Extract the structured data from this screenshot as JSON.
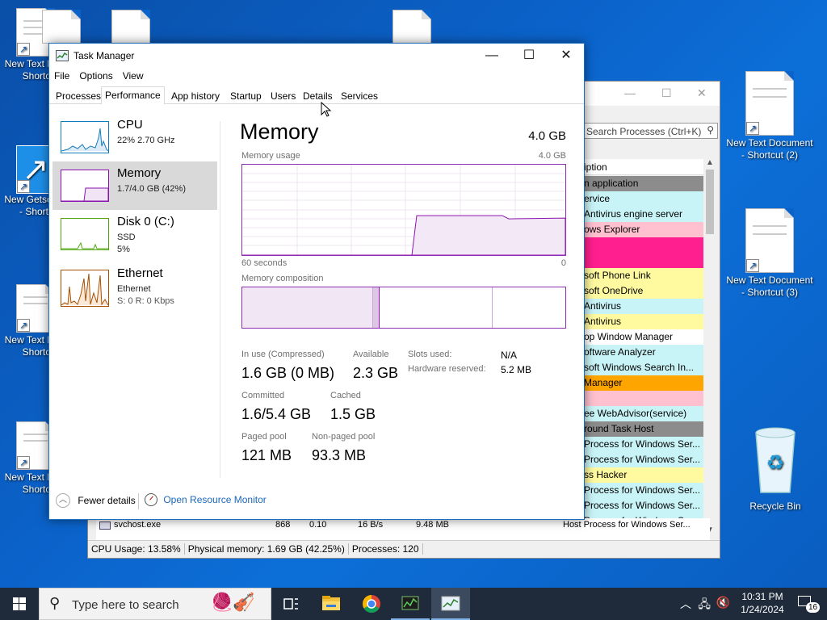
{
  "desktop": {
    "icons_left": [
      {
        "label": "New Text D... - Shortc",
        "label2": ""
      },
      {
        "label": "New Getscre... - Shortc",
        "label2": ""
      },
      {
        "label": "New Text D... - Shortc",
        "label2": ""
      },
      {
        "label": "New Text D... - Shortc",
        "label2": ""
      }
    ],
    "icons_right": [
      {
        "label": "New Text Document",
        "label2": "- Shortcut (2)"
      },
      {
        "label": "New Text Document",
        "label2": "- Shortcut (3)"
      }
    ],
    "recycle_bin": "Recycle Bin"
  },
  "background_window": {
    "search_placeholder": "Search Processes (Ctrl+K)",
    "column_header": "iption",
    "rows": [
      {
        "text": "n application",
        "color": "#8c8c8c"
      },
      {
        "text": "ervice",
        "color": "#c9f4f7"
      },
      {
        "text": "Antivirus engine server",
        "color": "#c9f4f7"
      },
      {
        "text": "ows Explorer",
        "color": "#ffc0d0"
      },
      {
        "text": "",
        "color": "#ff1f8f"
      },
      {
        "text": "",
        "color": "#ff1f8f"
      },
      {
        "text": "soft Phone Link",
        "color": "#fffaa0"
      },
      {
        "text": "soft OneDrive",
        "color": "#fffaa0"
      },
      {
        "text": "Antivirus",
        "color": "#c9f4f7"
      },
      {
        "text": "Antivirus",
        "color": "#fffaa0"
      },
      {
        "text": "op Window Manager",
        "color": "#ffffff"
      },
      {
        "text": "oftware Analyzer",
        "color": "#c9f4f7"
      },
      {
        "text": "soft Windows Search In...",
        "color": "#c9f4f7"
      },
      {
        "text": "Manager",
        "color": "#ffa500"
      },
      {
        "text": "",
        "color": "#ffc0d0"
      },
      {
        "text": "ee WebAdvisor(service)",
        "color": "#c9f4f7"
      },
      {
        "text": "round Task Host",
        "color": "#8c8c8c"
      },
      {
        "text": "Process for Windows Ser...",
        "color": "#c9f4f7"
      },
      {
        "text": "Process for Windows Ser...",
        "color": "#c9f4f7"
      },
      {
        "text": "ss Hacker",
        "color": "#fffaa0"
      },
      {
        "text": "Process for Windows Ser...",
        "color": "#c9f4f7"
      },
      {
        "text": "Process for Windows Ser...",
        "color": "#c9f4f7"
      },
      {
        "text": "Process for Windows Ser...",
        "color": "#c9f4f7"
      }
    ],
    "bottom_row": {
      "name": "svchost.exe",
      "pid": "868",
      "cpu": "0.10",
      "io": "16 B/s",
      "mem": "9.48 MB",
      "desc": "Host Process for Windows Ser..."
    },
    "status": {
      "cpu": "CPU Usage: 13.58%",
      "physical": "Physical memory: 1.69 GB (42.25%)",
      "processes": "Processes: 120"
    }
  },
  "task_manager": {
    "title": "Task Manager",
    "menu": [
      "File",
      "Options",
      "View"
    ],
    "tabs": [
      "Processes",
      "Performance",
      "App history",
      "Startup",
      "Users",
      "Details",
      "Services"
    ],
    "active_tab": "Performance",
    "perf_items": [
      {
        "name": "CPU",
        "sub1": "22% 2.70 GHz",
        "sub2": ""
      },
      {
        "name": "Memory",
        "sub1": "1.7/4.0 GB (42%)",
        "sub2": ""
      },
      {
        "name": "Disk 0 (C:)",
        "sub1": "SSD",
        "sub2": "5%"
      },
      {
        "name": "Ethernet",
        "sub1": "Ethernet",
        "sub2": "S: 0 R: 0 Kbps"
      }
    ],
    "memory": {
      "title": "Memory",
      "total": "4.0 GB",
      "usage_label": "Memory usage",
      "usage_max": "4.0 GB",
      "usage_fraction": 0.42,
      "time_left": "60 seconds",
      "time_right": "0",
      "composition_label": "Memory composition",
      "in_use_label": "In use (Compressed)",
      "in_use": "1.6 GB (0 MB)",
      "available_label": "Available",
      "available": "2.3 GB",
      "slots_label": "Slots used:",
      "slots": "N/A",
      "hw_reserved_label": "Hardware reserved:",
      "hw_reserved": "5.2 MB",
      "committed_label": "Committed",
      "committed": "1.6/5.4 GB",
      "cached_label": "Cached",
      "cached": "1.5 GB",
      "paged_label": "Paged pool",
      "paged": "121 MB",
      "nonpaged_label": "Non-paged pool",
      "nonpaged": "93.3 MB"
    },
    "fewer_details": "Fewer details",
    "open_resource_monitor": "Open Resource Monitor"
  },
  "taskbar": {
    "search_placeholder": "Type here to search",
    "time": "10:31 PM",
    "date": "1/24/2024",
    "notification_count": "16"
  }
}
